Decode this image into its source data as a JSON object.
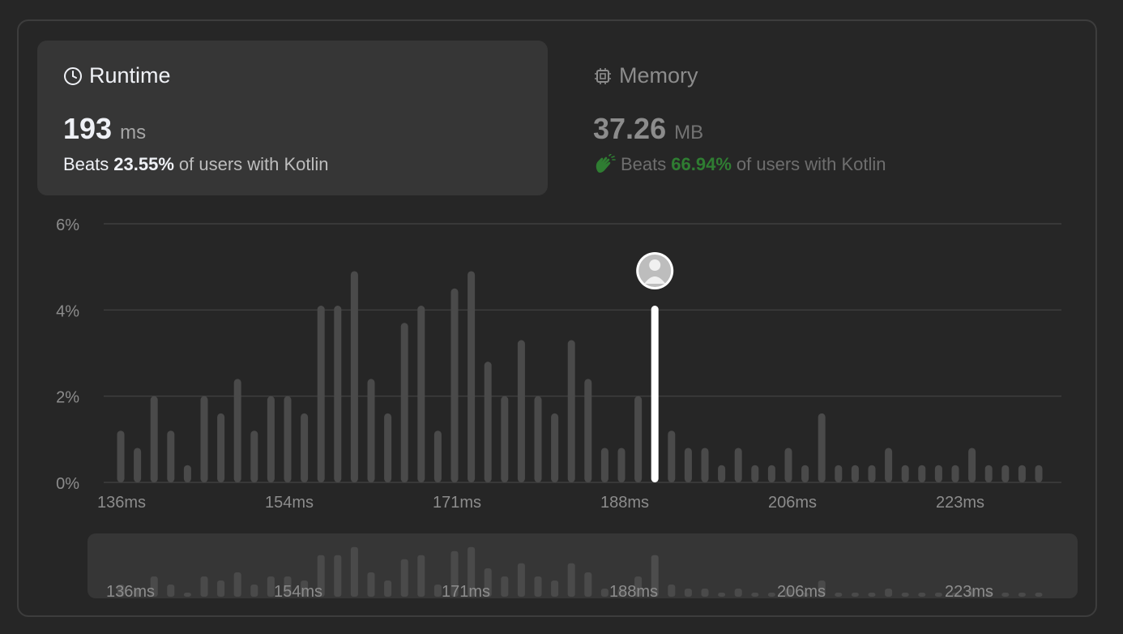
{
  "runtime": {
    "title": "Runtime",
    "value": "193",
    "unit": "ms",
    "beats_prefix": "Beats",
    "beats_pct": "23.55%",
    "beats_suffix": "of users with Kotlin"
  },
  "memory": {
    "title": "Memory",
    "value": "37.26",
    "unit": "MB",
    "beats_prefix": "Beats",
    "beats_pct": "66.94%",
    "beats_suffix": "of users with Kotlin"
  },
  "colors": {
    "bar": "#4a4a4a",
    "highlight": "#ffffff",
    "memory_accent": "#2f7d32"
  },
  "chart_data": {
    "type": "bar",
    "ylim": [
      0,
      6
    ],
    "yticks": [
      "0%",
      "2%",
      "4%",
      "6%"
    ],
    "xticks": [
      "136ms",
      "154ms",
      "171ms",
      "188ms",
      "206ms",
      "223ms"
    ],
    "values": [
      1.2,
      0.8,
      2.0,
      1.2,
      0.4,
      2.0,
      1.6,
      2.4,
      1.2,
      2.0,
      2.0,
      1.6,
      4.1,
      4.1,
      4.9,
      2.4,
      1.6,
      3.7,
      4.1,
      1.2,
      4.5,
      4.9,
      2.8,
      2.0,
      3.3,
      2.0,
      1.6,
      3.3,
      2.4,
      0.8,
      0.8,
      2.0,
      4.1,
      1.2,
      0.8,
      0.8,
      0.4,
      0.8,
      0.4,
      0.4,
      0.8,
      0.4,
      1.6,
      0.4,
      0.4,
      0.4,
      0.8,
      0.4,
      0.4,
      0.4,
      0.4,
      0.8,
      0.4,
      0.4,
      0.4,
      0.4
    ],
    "highlight_index": 32,
    "units": "%"
  }
}
